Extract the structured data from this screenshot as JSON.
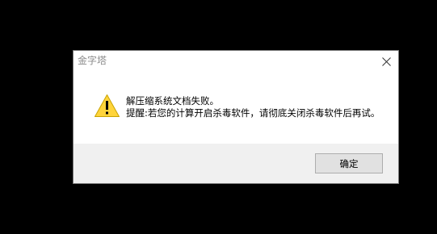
{
  "dialog": {
    "title": "金字塔",
    "close_icon": "close-icon",
    "icon": "warning-icon",
    "message_line1": "解压缩系统文档失败。",
    "message_line2": "提醒:若您的计算开启杀毒软件，请彻底关闭杀毒软件后再试。",
    "ok_label": "确定"
  },
  "colors": {
    "background": "#000000",
    "warning_fill": "#ffd43b",
    "footer": "#f0f0f0",
    "button": "#e1e1e1"
  }
}
